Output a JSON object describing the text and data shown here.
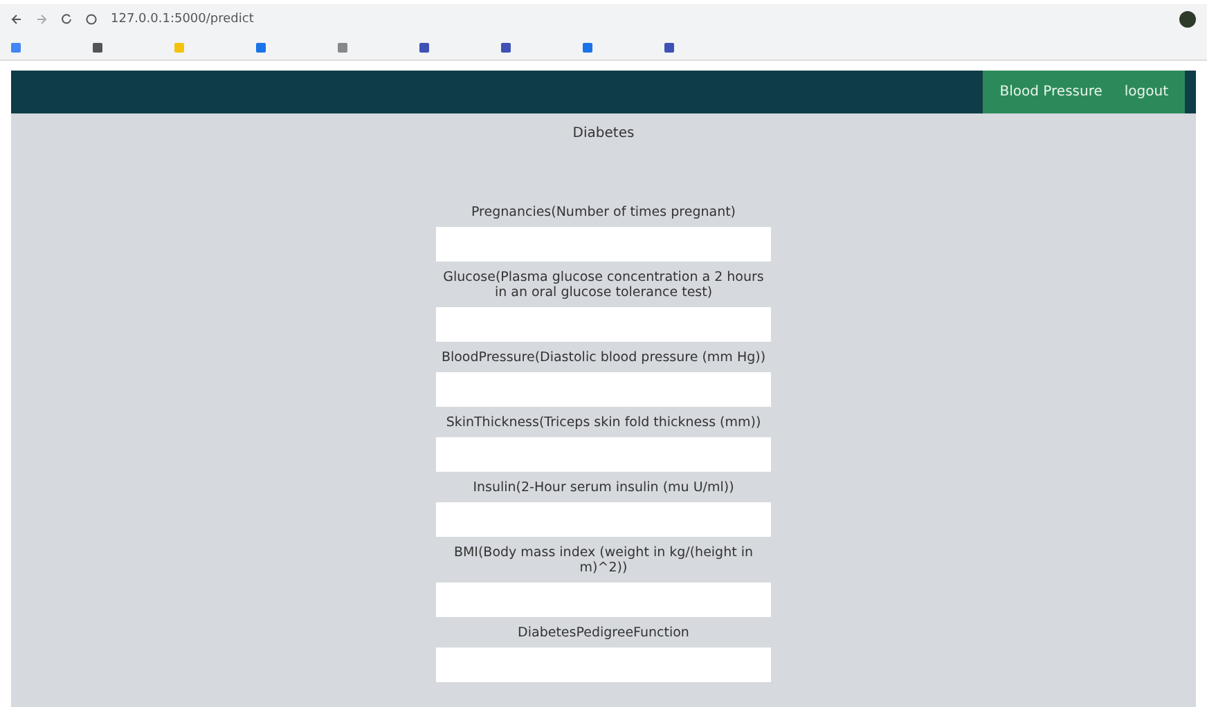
{
  "browser": {
    "address": "127.0.0.1:5000/predict"
  },
  "nav": {
    "items": [
      {
        "label": "Blood Pressure"
      },
      {
        "label": "logout"
      }
    ]
  },
  "page": {
    "title": "Diabetes"
  },
  "form": {
    "fields": [
      {
        "label": "Pregnancies(Number of times pregnant)"
      },
      {
        "label": "Glucose(Plasma glucose concentration a 2 hours in an oral glucose tolerance test)"
      },
      {
        "label": "BloodPressure(Diastolic blood pressure (mm Hg))"
      },
      {
        "label": "SkinThickness(Triceps skin fold thickness (mm))"
      },
      {
        "label": "Insulin(2-Hour serum insulin (mu U/ml))"
      },
      {
        "label": "BMI(Body mass index (weight in kg/(height in m)^2))"
      },
      {
        "label": "DiabetesPedigreeFunction"
      }
    ]
  }
}
